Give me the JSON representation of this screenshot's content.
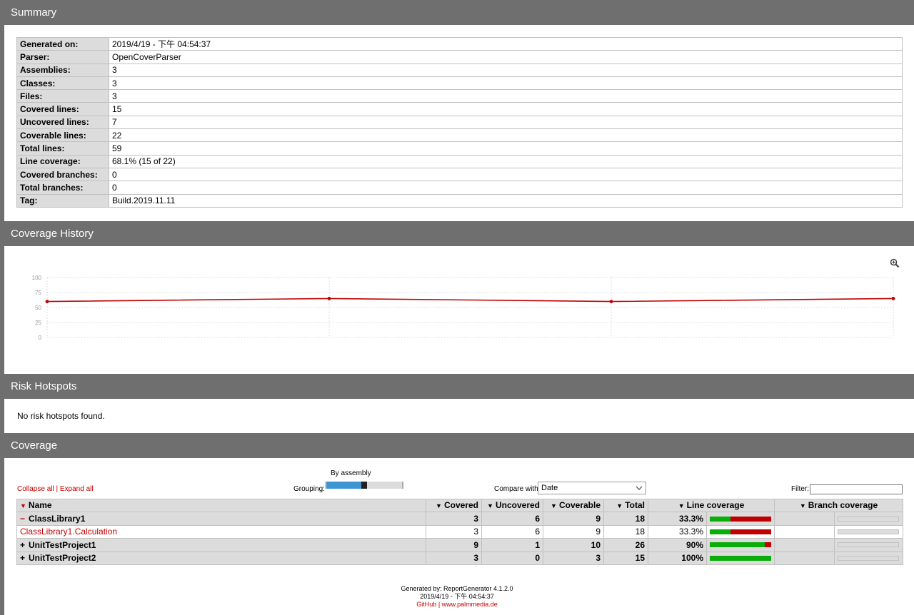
{
  "summary": {
    "title": "Summary",
    "rows": [
      {
        "label": "Generated on:",
        "value": "2019/4/19 - 下午 04:54:37"
      },
      {
        "label": "Parser:",
        "value": "OpenCoverParser"
      },
      {
        "label": "Assemblies:",
        "value": "3"
      },
      {
        "label": "Classes:",
        "value": "3"
      },
      {
        "label": "Files:",
        "value": "3"
      },
      {
        "label": "Covered lines:",
        "value": "15"
      },
      {
        "label": "Uncovered lines:",
        "value": "7"
      },
      {
        "label": "Coverable lines:",
        "value": "22"
      },
      {
        "label": "Total lines:",
        "value": "59"
      },
      {
        "label": "Line coverage:",
        "value": "68.1% (15 of 22)"
      },
      {
        "label": "Covered branches:",
        "value": "0"
      },
      {
        "label": "Total branches:",
        "value": "0"
      },
      {
        "label": "Tag:",
        "value": "Build.2019.11.11"
      }
    ]
  },
  "history": {
    "title": "Coverage History",
    "zoom_icon": "zoom-in-icon",
    "chart_data": {
      "type": "line",
      "title": "",
      "xlabel": "",
      "ylabel": "",
      "ylim": [
        0,
        100
      ],
      "yticks": [
        "100",
        "75",
        "50",
        "25",
        "0"
      ],
      "x": [
        1,
        2,
        3,
        4
      ],
      "series": [
        {
          "values": [
            60,
            65,
            60,
            65
          ],
          "color": "#c00000"
        }
      ],
      "grid": true
    }
  },
  "risk": {
    "title": "Risk Hotspots",
    "message": "No risk hotspots found."
  },
  "coverage": {
    "title": "Coverage",
    "collapse_all": "Collapse all",
    "separator": "|",
    "expand_all": "Expand all",
    "grouping_label": "Grouping:",
    "grouping_value": "By assembly",
    "grouping_level": 0.5,
    "compare_label": "Compare with:",
    "compare_value": "Date",
    "filter_label": "Filter:",
    "filter_value": "",
    "columns": {
      "name": "Name",
      "covered": "Covered",
      "uncovered": "Uncovered",
      "coverable": "Coverable",
      "total": "Total",
      "line_coverage": "Line coverage",
      "branch_coverage": "Branch coverage"
    },
    "rows": [
      {
        "type": "assembly",
        "toggle": "minus",
        "name": "ClassLibrary1",
        "covered": "3",
        "uncovered": "6",
        "coverable": "9",
        "total": "18",
        "percent": "33.3%",
        "ratio": 0.333
      },
      {
        "type": "class",
        "toggle": "",
        "name": "ClassLibrary1.Calculation",
        "covered": "3",
        "uncovered": "6",
        "coverable": "9",
        "total": "18",
        "percent": "33.3%",
        "ratio": 0.333
      },
      {
        "type": "assembly",
        "toggle": "plus",
        "name": "UnitTestProject1",
        "covered": "9",
        "uncovered": "1",
        "coverable": "10",
        "total": "26",
        "percent": "90%",
        "ratio": 0.9
      },
      {
        "type": "assembly",
        "toggle": "plus",
        "name": "UnitTestProject2",
        "covered": "3",
        "uncovered": "0",
        "coverable": "3",
        "total": "15",
        "percent": "100%",
        "ratio": 1.0
      }
    ]
  },
  "footer": {
    "generated_by": "Generated by: ReportGenerator 4.1.2.0",
    "date": "2019/4/19 - 下午 04:54:37",
    "github": "GitHub",
    "separator": "|",
    "website": "www.palmmedia.de"
  },
  "colors": {
    "header_bg": "#6f6f6f",
    "link": "#c00000",
    "covered": "#0aad0a",
    "uncovered": "#c00000",
    "slider": "#3d95d1"
  }
}
